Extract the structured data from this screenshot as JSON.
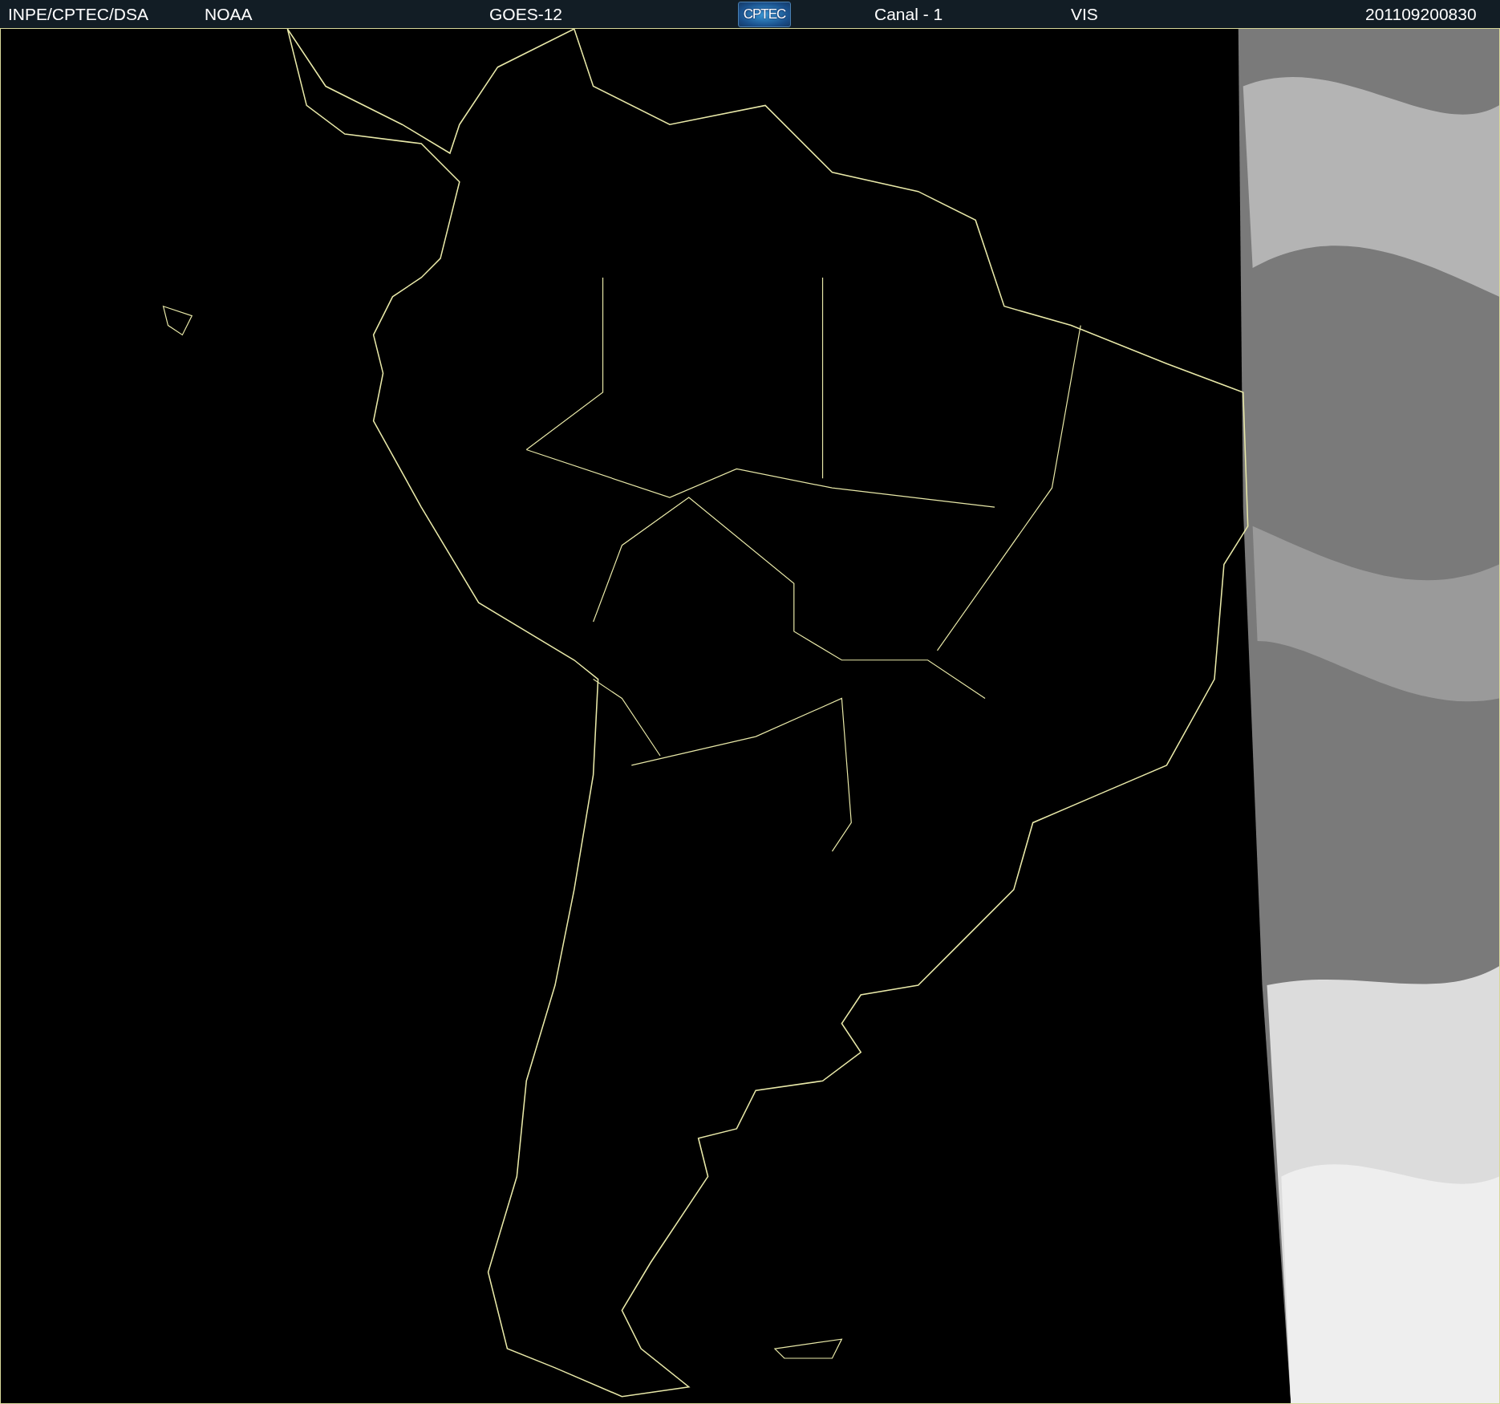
{
  "header": {
    "items": [
      {
        "kind": "text",
        "text": "INPE/CPTEC/DSA"
      },
      {
        "kind": "text",
        "text": "NOAA"
      },
      {
        "kind": "text",
        "text": "GOES-12"
      },
      {
        "kind": "logo",
        "text": "CPTEC"
      },
      {
        "kind": "text",
        "text": "Canal - 1"
      },
      {
        "kind": "text",
        "text": "VIS"
      },
      {
        "kind": "text",
        "text": "201109200830"
      }
    ]
  }
}
